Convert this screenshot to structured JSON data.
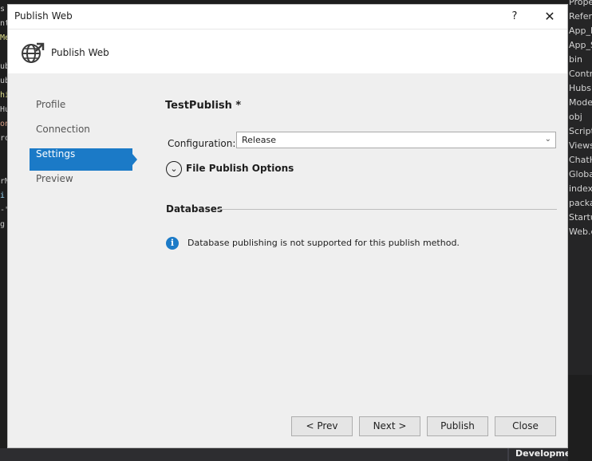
{
  "ide": {
    "code_fragments": [
      "s",
      "nt",
      "Me",
      "",
      "ub",
      "ub",
      "hi",
      "Hu",
      "on",
      "ro",
      "",
      "",
      "rM",
      "i",
      "-\"",
      "g"
    ],
    "code_colors": [
      "#c8c8c8",
      "#c8c8c8",
      "#dcdc8b",
      "",
      "#c8c8c8",
      "#c8c8c8",
      "#dcdc8b",
      "#c8c8c8",
      "#d69d85",
      "#c8c8c8",
      "",
      "",
      "#c8c8c8",
      "#9cdcfe",
      "#c8c8c8",
      "#c8c8c8"
    ],
    "solution_items": [
      "Prope",
      "Refere",
      "App_D",
      "App_S",
      "bin",
      "Contr",
      "Hubs",
      "Mode",
      "obj",
      "Script",
      "Views",
      "ChatH",
      "Globa",
      "index.",
      "packa",
      "Startu",
      "Web.c"
    ],
    "bottom_label": "Development"
  },
  "dialog": {
    "title": "Publish Web",
    "help_label": "?",
    "close_label": "✕",
    "header_title": "Publish Web",
    "header_icon": "globe-publish-icon",
    "nav": [
      {
        "label": "Profile",
        "active": false
      },
      {
        "label": "Connection",
        "active": false
      },
      {
        "label": "Settings",
        "active": true
      },
      {
        "label": "Preview",
        "active": false
      }
    ],
    "profile_name": "TestPublish *",
    "configuration": {
      "label": "Configuration:",
      "value": "Release",
      "chevron": "⌄"
    },
    "file_publish_options": {
      "label": "File Publish Options",
      "expander_glyph": "⌄"
    },
    "databases": {
      "header": "Databases",
      "info_icon": "i",
      "info_text": "Database publishing is not supported for this publish method."
    },
    "buttons": {
      "prev": "< Prev",
      "next": "Next >",
      "publish": "Publish",
      "close": "Close"
    },
    "colors": {
      "accent": "#1b7ac7",
      "content_bg": "#efefef"
    }
  }
}
